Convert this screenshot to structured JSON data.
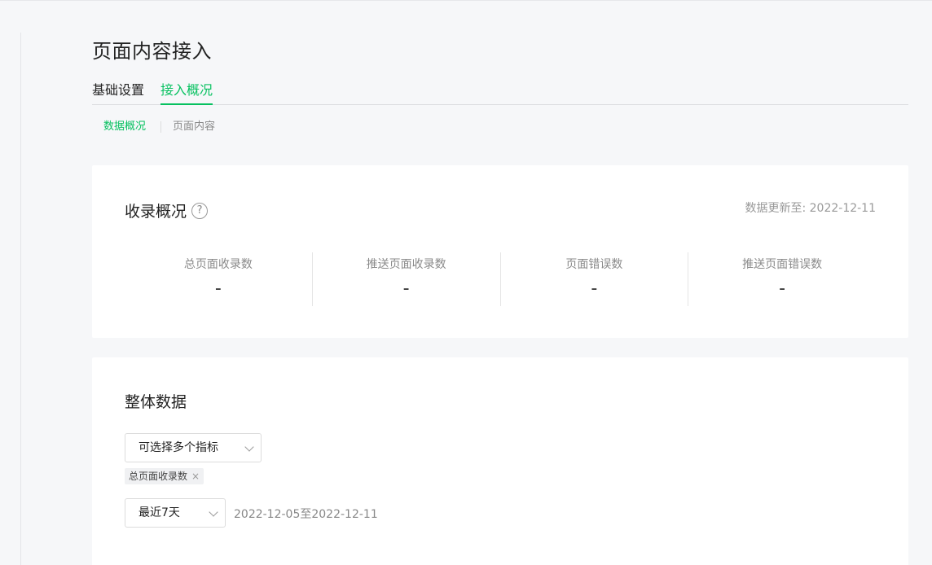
{
  "page": {
    "title": "页面内容接入"
  },
  "tabs": [
    {
      "label": "基础设置",
      "active": false
    },
    {
      "label": "接入概况",
      "active": true
    }
  ],
  "subtabs": [
    {
      "label": "数据概况",
      "active": true
    },
    {
      "label": "页面内容",
      "active": false
    }
  ],
  "overview": {
    "title": "收录概况",
    "help_icon": "question-circle-icon",
    "help_glyph": "?",
    "update_time": "数据更新至: 2022-12-11",
    "stats": [
      {
        "label": "总页面收录数",
        "value": "-"
      },
      {
        "label": "推送页面收录数",
        "value": "-"
      },
      {
        "label": "页面错误数",
        "value": "-"
      },
      {
        "label": "推送页面错误数",
        "value": "-"
      }
    ]
  },
  "overall": {
    "title": "整体数据",
    "metric_select": {
      "placeholder": "可选择多个指标"
    },
    "selected_tag": {
      "label": "总页面收录数",
      "close_glyph": "×"
    },
    "period_select": {
      "value": "最近7天"
    },
    "date_range": "2022-12-05至2022-12-11"
  },
  "colors": {
    "accent": "#07c160",
    "background": "#f6f7f9",
    "card": "#ffffff"
  }
}
